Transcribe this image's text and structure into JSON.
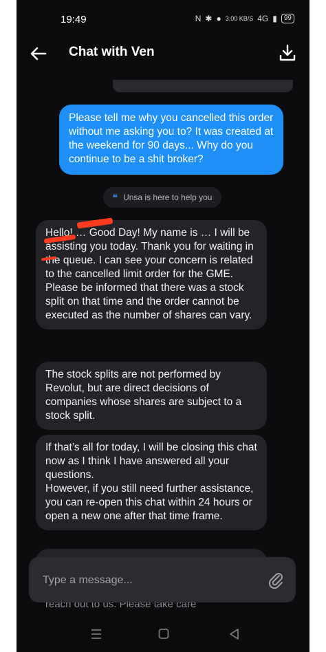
{
  "status_bar": {
    "time": "19:49",
    "net_speed": "3.00 KB/S",
    "network": "4G",
    "battery": "99"
  },
  "header": {
    "title": "Chat with Ven"
  },
  "messages": {
    "partial_top": "",
    "user_1": "Please tell me why you cancelled this order without me asking you to? It was created at the weekend for 90 days... Why do you continue to be a shit broker?",
    "system_chip": "Unsa is here to help you",
    "agent_1": "Hello! … Good Day! My name is … I will be assisting you today. Thank you for waiting in the queue. I can see your concern is related to the cancelled limit order for the GME. Please be informed that there was a stock split on that time and the order cannot be executed as the number of shares can vary.",
    "agent_2": "The stock splits are not performed by Revolut, but are direct decisions of companies whose shares are subject to a stock split.",
    "agent_3": "If that’s all for today, I will be closing this chat now as I think I have answered all your questions.\nHowever, if you still need further assistance, you can re-open this chat within 24 hours or open a new one after that time frame.",
    "agent_4_partial": "reach out to us. Please take care"
  },
  "composer": {
    "placeholder": "Type a message..."
  },
  "colors": {
    "user_bubble": "#1e8ff5",
    "agent_bubble": "#232328",
    "background": "#0c0c0f",
    "accent": "#3c8ef2"
  },
  "icons": [
    "back-arrow-icon",
    "download-icon",
    "chat-bubbles-icon",
    "paperclip-icon",
    "menu-icon",
    "home-square-icon",
    "back-triangle-icon"
  ]
}
